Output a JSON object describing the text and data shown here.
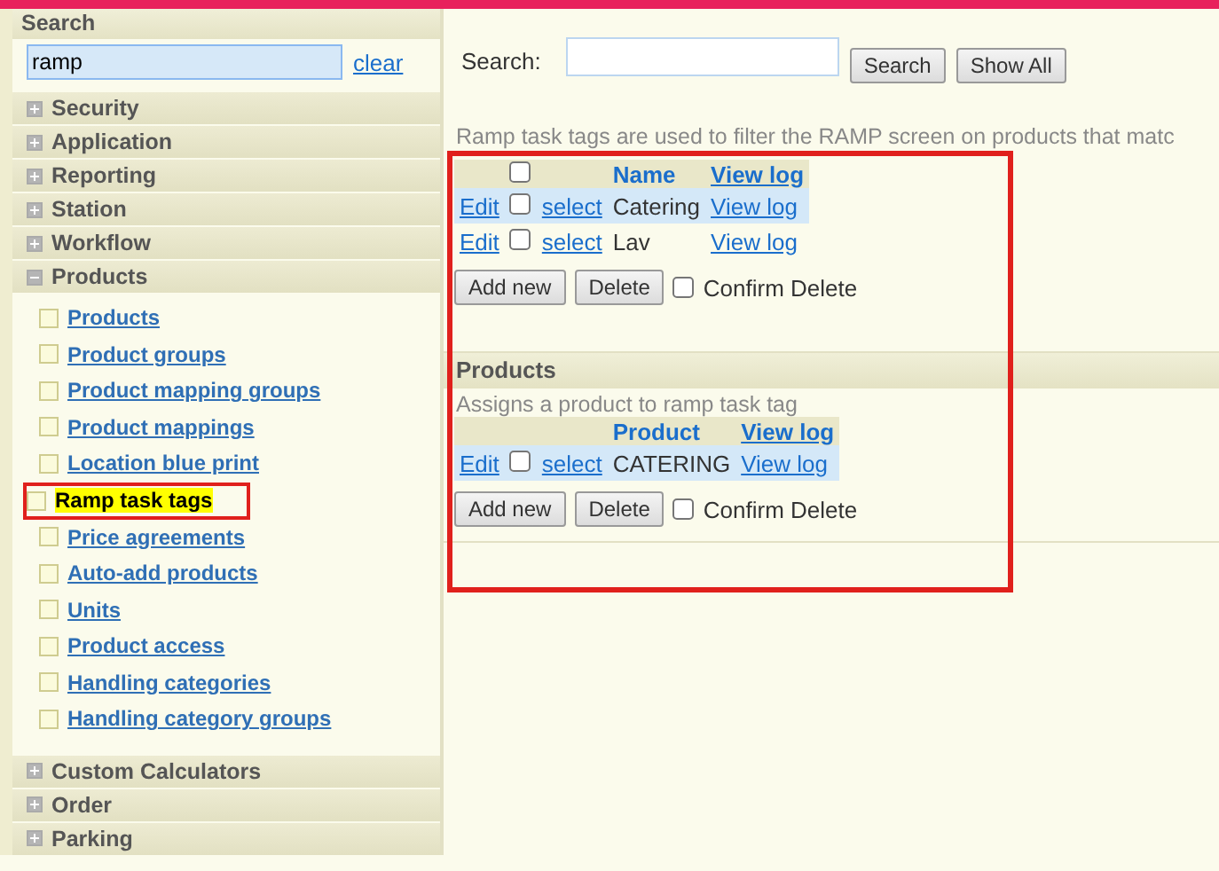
{
  "sidebar": {
    "search_title": "Search",
    "search_value": "ramp",
    "clear_link": "clear",
    "groups": [
      {
        "label": "Security",
        "expanded": false
      },
      {
        "label": "Application",
        "expanded": false
      },
      {
        "label": "Reporting",
        "expanded": false
      },
      {
        "label": "Station",
        "expanded": false
      },
      {
        "label": "Workflow",
        "expanded": false
      },
      {
        "label": "Products",
        "expanded": true,
        "children": [
          {
            "label": "Products",
            "selected": false
          },
          {
            "label": "Product groups",
            "selected": false
          },
          {
            "label": "Product mapping groups",
            "selected": false
          },
          {
            "label": "Product mappings",
            "selected": false
          },
          {
            "label": "Location blue print",
            "selected": false
          },
          {
            "label": "Ramp task tags",
            "selected": true
          },
          {
            "label": "Price agreements",
            "selected": false
          },
          {
            "label": "Auto-add products",
            "selected": false
          },
          {
            "label": "Units",
            "selected": false
          },
          {
            "label": "Product access",
            "selected": false
          },
          {
            "label": "Handling categories",
            "selected": false
          },
          {
            "label": "Handling category groups",
            "selected": false
          }
        ]
      },
      {
        "label": "Custom Calculators",
        "expanded": false
      },
      {
        "label": "Order",
        "expanded": false
      },
      {
        "label": "Parking",
        "expanded": false
      }
    ]
  },
  "main": {
    "search_label": "Search:",
    "search_button": "Search",
    "show_all_button": "Show All",
    "sections": [
      {
        "description": "Ramp task tags are used to filter the RAMP screen on products that matc",
        "header_checked": false,
        "columns": [
          "Name",
          "View log"
        ],
        "rows": [
          {
            "edit": "Edit",
            "select": "select",
            "value": "Catering",
            "log": "View log",
            "checked": false
          },
          {
            "edit": "Edit",
            "select": "select",
            "value": "Lav",
            "log": "View log",
            "checked": false
          }
        ],
        "add_button": "Add new",
        "delete_button": "Delete",
        "confirm_label": "Confirm Delete",
        "confirm_checked": false
      },
      {
        "title": "Products",
        "description": "Assigns a product to ramp task tag",
        "columns": [
          "Product",
          "View log"
        ],
        "rows": [
          {
            "edit": "Edit",
            "select": "select",
            "value": "CATERING",
            "log": "View log",
            "checked": false
          }
        ],
        "add_button": "Add new",
        "delete_button": "Delete",
        "confirm_label": "Confirm Delete",
        "confirm_checked": false
      }
    ]
  }
}
